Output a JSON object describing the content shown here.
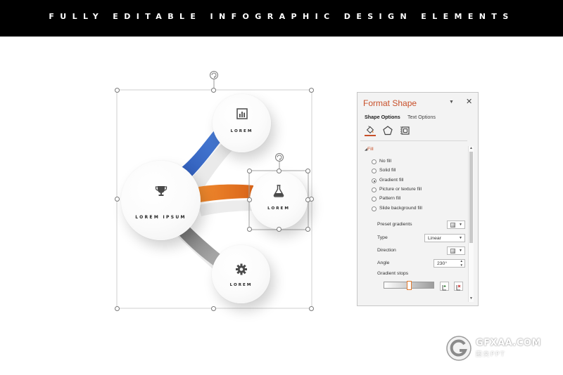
{
  "banner": {
    "text": "FULLY EDITABLE INFOGRAPHIC DESIGN ELEMENTS"
  },
  "infographic": {
    "main": {
      "label": "LOREM IPSUM",
      "icon": "trophy-icon"
    },
    "top": {
      "label": "LOREM",
      "icon": "bar-chart-icon",
      "connector_color": "#3d6cc6"
    },
    "middle": {
      "label": "LOREM",
      "icon": "flask-icon",
      "connector_color": "#e8761f"
    },
    "bottom": {
      "label": "LOREM",
      "icon": "gear-icon",
      "connector_color": "#8c8c8c"
    }
  },
  "format_pane": {
    "title": "Format Shape",
    "close_icon": "close-icon",
    "tabs": [
      {
        "label": "Shape Options",
        "active": true
      },
      {
        "label": "Text Options",
        "active": false
      }
    ],
    "tool_icons": [
      "fill-line-icon",
      "effects-pentagon-icon",
      "size-properties-icon"
    ],
    "section": "Fill",
    "fill_options": [
      {
        "label": "No fill",
        "selected": false
      },
      {
        "label": "Solid fill",
        "selected": false
      },
      {
        "label": "Gradient fill",
        "selected": true
      },
      {
        "label": "Picture or texture fill",
        "selected": false
      },
      {
        "label": "Pattern fill",
        "selected": false
      },
      {
        "label": "Slide background fill",
        "selected": false
      }
    ],
    "preset_gradients_label": "Preset gradients",
    "type_label": "Type",
    "type_value": "Linear",
    "direction_label": "Direction",
    "angle_label": "Angle",
    "angle_value": "230°",
    "gradient_stops_label": "Gradient stops",
    "accent_color": "#c8502a"
  },
  "watermark": {
    "main": "GFXAA.COM",
    "sub": "图夹PPT"
  }
}
